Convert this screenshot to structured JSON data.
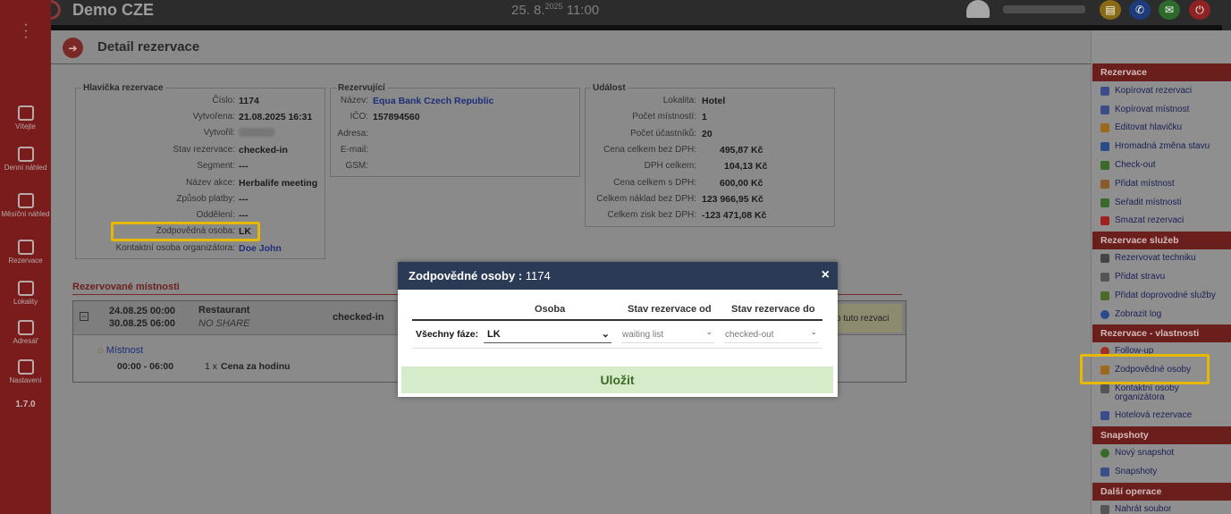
{
  "app": {
    "title": "Demo CZE",
    "date_day": "25. 8.",
    "date_year": "2025",
    "time": "11:00",
    "version": "1.7.0"
  },
  "top_icons": [
    {
      "name": "book-icon",
      "color": "#8a6a14"
    },
    {
      "name": "phone-icon",
      "color": "#1e3c7a"
    },
    {
      "name": "chat-icon",
      "color": "#2e6a2c"
    },
    {
      "name": "power-icon",
      "color": "#8f2323"
    }
  ],
  "nav": [
    {
      "id": "vitejte",
      "label": "Vítejte"
    },
    {
      "id": "denni",
      "label": "Denní náhled"
    },
    {
      "id": "mesicni",
      "label": "Měsíční náhled"
    },
    {
      "id": "rezervace",
      "label": "Rezervace"
    },
    {
      "id": "lokality",
      "label": "Lokality"
    },
    {
      "id": "adresar",
      "label": "Adresář"
    },
    {
      "id": "nastaveni",
      "label": "Nastavení"
    }
  ],
  "page": {
    "title": "Detail rezervace"
  },
  "header_box": {
    "legend": "Hlavička rezervace",
    "rows": [
      {
        "label": "Číslo:",
        "value": "1174"
      },
      {
        "label": "Vytvořena:",
        "value": "21.08.2025 16:31"
      },
      {
        "label": "Vytvořil:",
        "value": ""
      },
      {
        "label": "Stav rezervace:",
        "value": "checked-in"
      },
      {
        "label": "Segment:",
        "value": "---"
      },
      {
        "label": "Název akce:",
        "value": "Herbalife meeting"
      },
      {
        "label": "Způsob platby:",
        "value": "---"
      },
      {
        "label": "Oddělení:",
        "value": "---"
      },
      {
        "label": "Zodpovědná osoba:",
        "value": "LK"
      },
      {
        "label": "Kontaktní osoba organizátora:",
        "value": "Doe John"
      }
    ]
  },
  "booker_box": {
    "legend": "Rezervující",
    "rows": [
      {
        "label": "Název:",
        "value": "Equa Bank Czech Republic"
      },
      {
        "label": "IČO:",
        "value": "157894560"
      },
      {
        "label": "Adresa:",
        "value": ""
      },
      {
        "label": "E-mail:",
        "value": ""
      },
      {
        "label": "GSM:",
        "value": ""
      }
    ]
  },
  "event_box": {
    "legend": "Událost",
    "rows": [
      {
        "label": "Lokalita:",
        "value": "Hotel"
      },
      {
        "label": "Počet místností:",
        "value": "1"
      },
      {
        "label": "Počet účastníků:",
        "value": "20"
      },
      {
        "label": "Cena celkem bez DPH:",
        "value": "495,87 Kč"
      },
      {
        "label": "DPH celkem:",
        "value": "104,13 Kč"
      },
      {
        "label": "Cena celkem s DPH:",
        "value": "600,00 Kč"
      },
      {
        "label": "Celkem náklad bez DPH:",
        "value": "123 966,95 Kč"
      },
      {
        "label": "Celkem zisk bez DPH:",
        "value": "-123 471,08 Kč"
      }
    ]
  },
  "rooms": {
    "title": "Rezervované místnosti",
    "collapse": "−",
    "from": "24.08.25 00:00",
    "to": "30.08.25 06:00",
    "room_name": "Restaurant",
    "share": "NO SHARE",
    "status": "checked-in",
    "note": "o tuto rezvaci",
    "sub_label": "Místnost",
    "sub_time": "00:00 - 06:00",
    "sub_qty": "1 x",
    "sub_item": "Cena za hodinu"
  },
  "right_panel": {
    "sections": [
      {
        "title": "Rezervace",
        "items": [
          {
            "label": "Kopírovat rezervaci",
            "color": "#3a4d8a"
          },
          {
            "label": "Kopírovat místnost",
            "color": "#3a4d8a"
          },
          {
            "label": "Editovat hlavičku",
            "color": "#9a6a1a"
          },
          {
            "label": "Hromadná změna stavu",
            "color": "#2a4a8a"
          },
          {
            "label": "Check-out",
            "color": "#3a6a2a"
          },
          {
            "label": "Přidat místnost",
            "color": "#8a5a2a"
          },
          {
            "label": "Seřadit místnosti",
            "color": "#3a6a2a"
          },
          {
            "label": "Smazat rezervaci",
            "color": "#a02020"
          }
        ]
      },
      {
        "title": "Rezervace služeb",
        "items": [
          {
            "label": "Rezervovat techniku",
            "color": "#444"
          },
          {
            "label": "Přidat stravu",
            "color": "#555"
          },
          {
            "label": "Přidat doprovodné služby",
            "color": "#4a6a2a"
          },
          {
            "label": "Zobrazit log",
            "color": "#2a4a8a"
          }
        ]
      },
      {
        "title": "Rezervace - vlastnosti",
        "items": [
          {
            "label": "Follow-up",
            "color": "#a03020"
          },
          {
            "label": "Zodpovědné osoby",
            "color": "#9a6a1a"
          },
          {
            "label": "Kontaktní osoby organizátora",
            "color": "#555"
          },
          {
            "label": "Hotelová rezervace",
            "color": "#3a4d8a"
          }
        ]
      },
      {
        "title": "Snapshoty",
        "items": [
          {
            "label": "Nový snapshot",
            "color": "#3a6a2a"
          },
          {
            "label": "Snapshoty",
            "color": "#3a4d8a"
          }
        ]
      },
      {
        "title": "Další operace",
        "items": [
          {
            "label": "Nahrát soubor",
            "color": "#555"
          }
        ]
      }
    ]
  },
  "modal": {
    "title_prefix": "Zodpovědné osoby :",
    "title_id": "1174",
    "close": "×",
    "col_person": "Osoba",
    "col_from": "Stav rezervace od",
    "col_to": "Stav rezervace do",
    "phase_label": "Všechny fáze:",
    "person_value": "LK",
    "from_value": "waiting list",
    "to_value": "checked-out",
    "save": "Uložit"
  }
}
